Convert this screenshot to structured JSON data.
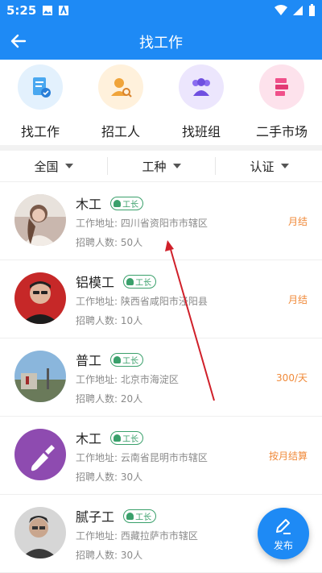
{
  "status_bar": {
    "time": "5:25"
  },
  "app_bar": {
    "title": "找工作",
    "back_icon": "arrow-left-icon"
  },
  "categories": [
    {
      "label": "找工作",
      "icon": "document-check-icon",
      "color": "#4aa8f0",
      "bg": "#e3f1fd"
    },
    {
      "label": "招工人",
      "icon": "person-search-icon",
      "color": "#f0a43a",
      "bg": "#fff1dc"
    },
    {
      "label": "找班组",
      "icon": "group-icon",
      "color": "#8a6cf0",
      "bg": "#ece6fd"
    },
    {
      "label": "二手市场",
      "icon": "shopping-bag-icon",
      "color": "#f0508a",
      "bg": "#fde2ec"
    }
  ],
  "filters": [
    {
      "label": "全国"
    },
    {
      "label": "工种"
    },
    {
      "label": "认证"
    }
  ],
  "jobs": [
    {
      "title": "木工",
      "badge": "工长",
      "address": "工作地址: 四川省资阳市市辖区",
      "count": "招聘人数: 50人",
      "pay": "月结"
    },
    {
      "title": "铝模工",
      "badge": "工长",
      "address": "工作地址: 陕西省咸阳市泾阳县",
      "count": "招聘人数: 10人",
      "pay": "月结"
    },
    {
      "title": "普工",
      "badge": "工长",
      "address": "工作地址: 北京市海淀区",
      "count": "招聘人数: 20人",
      "pay": "300/天"
    },
    {
      "title": "木工",
      "badge": "工长",
      "address": "工作地址: 云南省昆明市市辖区",
      "count": "招聘人数: 30人",
      "pay": "按月结算"
    },
    {
      "title": "腻子工",
      "badge": "工长",
      "address": "工作地址: 西藏拉萨市市辖区",
      "count": "招聘人数: 30人",
      "pay": ""
    }
  ],
  "fab": {
    "label": "发布",
    "icon": "pen-icon"
  },
  "colors": {
    "primary": "#1e8af5",
    "pay": "#f08a3a",
    "badge": "#3aa06b",
    "annotation_arrow": "#d0202a"
  }
}
